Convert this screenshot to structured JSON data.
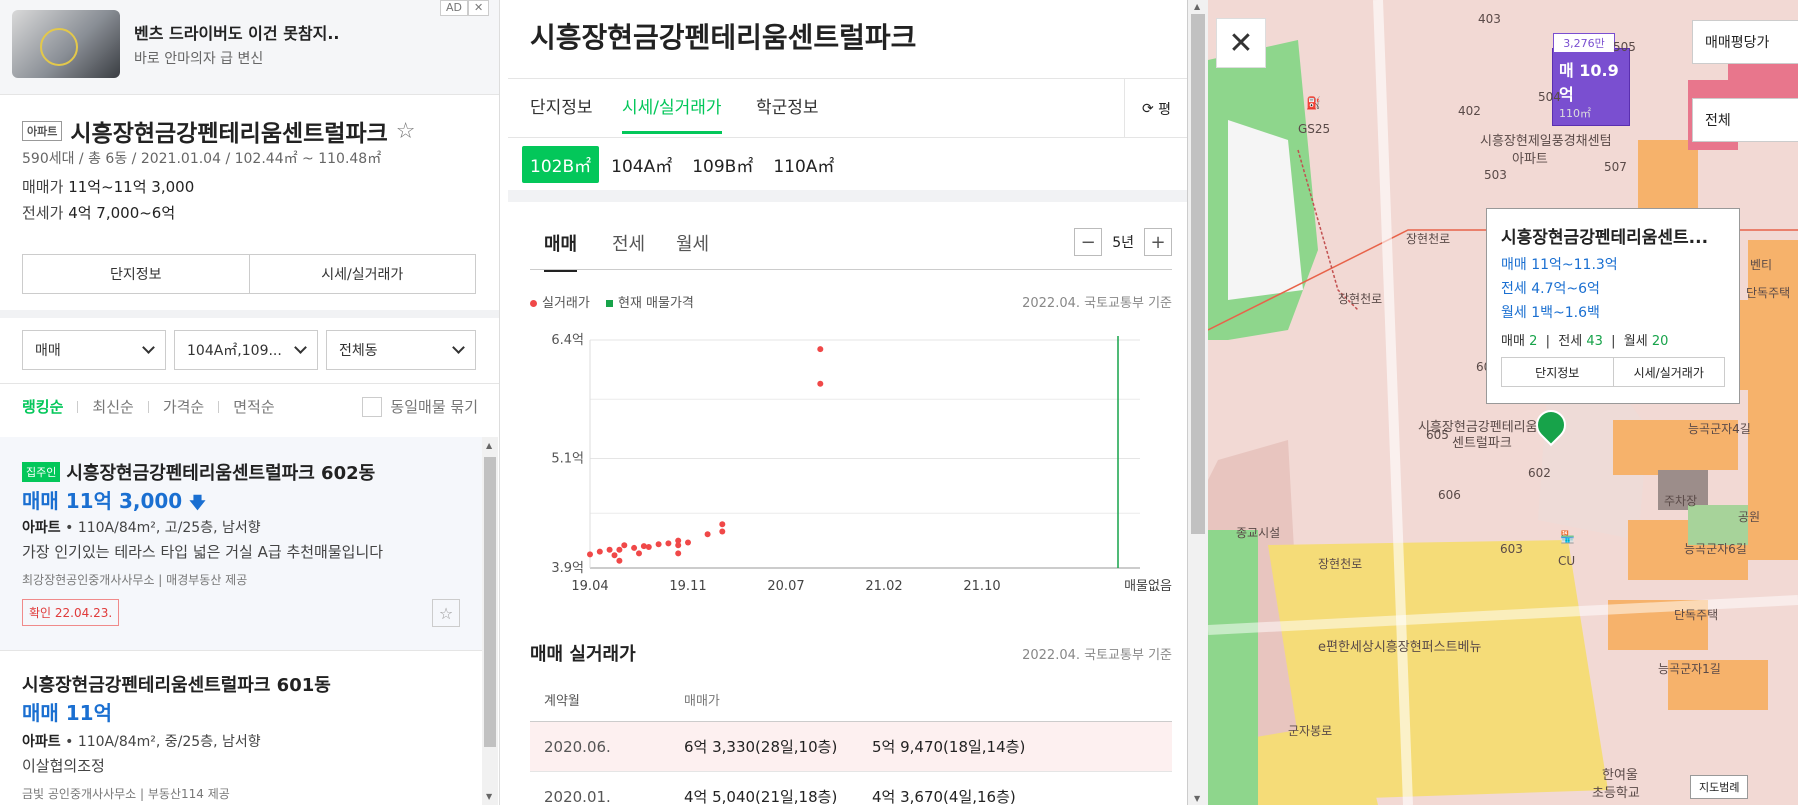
{
  "ad": {
    "badge": "AD",
    "close": "✕",
    "title": "벤츠 드라이버도 이건 못참지..",
    "subtitle": "바로 안마의자 급 변신"
  },
  "complex": {
    "tag": "아파트",
    "name": "시흥장현금강펜테리움센트럴파크",
    "star": "☆",
    "meta": "590세대 / 총 6동 / 2021.01.04 / 102.44㎡ ~ 110.48㎡",
    "sale_label": "매매가",
    "sale_value": "11억~11억 3,000",
    "jeonse_label": "전세가",
    "jeonse_value": "4억 7,000~6억",
    "btn_info": "단지정보",
    "btn_price": "시세/실거래가"
  },
  "filters": {
    "deal": "매매",
    "area": "104A㎡,109...",
    "dong": "전체동"
  },
  "sort": {
    "items": [
      "랭킹순",
      "최신순",
      "가격순",
      "면적순"
    ],
    "group": "동일매물 묶기"
  },
  "listings": [
    {
      "owner": "집주인",
      "name": "시흥장현금강펜테리움센트럴파크 602동",
      "price": "매매 11억 3,000",
      "type": "아파트",
      "spec": "110A/84m², 고/25층, 남서향",
      "desc": "가장 인기있는 테라스 타입 넓은 거실 A급 추천매물입니다",
      "agent": "최강장현공인중개사사무소",
      "source": "매경부동산 제공",
      "confirm": "확인 22.04.23."
    },
    {
      "name": "시흥장현금강펜테리움센트럴파크 601동",
      "price": "매매 11억",
      "type": "아파트",
      "spec": "110A/84m², 중/25층, 남서향",
      "desc": "이살협의조정",
      "agent": "금빛 공인중개사사무소",
      "source": "부동산114 제공"
    }
  ],
  "detail": {
    "title": "시흥장현금강펜테리움센트럴파크",
    "tabs": [
      "단지정보",
      "시세/실거래가",
      "학군정보"
    ],
    "unit_toggle": "평",
    "sizes": [
      "102B㎡",
      "104A㎡",
      "109B㎡",
      "110A㎡"
    ],
    "trade_tabs": [
      "매매",
      "전세",
      "월세"
    ],
    "period": "5년",
    "legend_actual": "실거래가",
    "legend_current": "현재 매물가격",
    "source": "2022.04. 국토교통부 기준",
    "table_title": "매매 실거래가",
    "table_head": [
      "계약월",
      "매매가"
    ],
    "rows": [
      {
        "month": "2020.06.",
        "p1": "6억 3,330(28일,10층)",
        "p2": "5억 9,470(18일,14층)"
      },
      {
        "month": "2020.01.",
        "p1": "4억 5,040(21일,18층)",
        "p2": "4억 3,670(4일,16층)"
      }
    ]
  },
  "chart_data": {
    "type": "scatter",
    "ylim": [
      3.9,
      6.4
    ],
    "yticks": [
      "6.4억",
      "5.1억",
      "3.9억"
    ],
    "xticks": [
      "19.04",
      "19.11",
      "20.07",
      "21.02",
      "21.10",
      "매물없음"
    ],
    "series": [
      {
        "name": "실거래가",
        "color": "#f04848",
        "points": [
          [
            0.0,
            4.05
          ],
          [
            0.1,
            4.08
          ],
          [
            0.2,
            4.1
          ],
          [
            0.25,
            4.04
          ],
          [
            0.3,
            3.98
          ],
          [
            0.3,
            4.1
          ],
          [
            0.35,
            4.15
          ],
          [
            0.45,
            4.12
          ],
          [
            0.5,
            4.06
          ],
          [
            0.55,
            4.14
          ],
          [
            0.6,
            4.13
          ],
          [
            0.7,
            4.16
          ],
          [
            0.8,
            4.17
          ],
          [
            0.9,
            4.15
          ],
          [
            0.9,
            4.06
          ],
          [
            0.9,
            4.2
          ],
          [
            1.0,
            4.18
          ],
          [
            1.2,
            4.27
          ],
          [
            1.35,
            4.3
          ],
          [
            1.35,
            4.38
          ],
          [
            2.35,
            6.3
          ],
          [
            2.35,
            5.92
          ]
        ]
      },
      {
        "name": "현재 매물가격",
        "color": "#17a34a",
        "points": []
      }
    ]
  },
  "map": {
    "close": "✕",
    "price_type": "매매평당가",
    "filter": "전체",
    "marker_top": "3,276만",
    "marker_price": "매 10.9억",
    "marker_area": "110㎡",
    "popup": {
      "title": "시흥장현금강펜테리움센트...",
      "sale": "매매 11억~11.3억",
      "jeonse": "전세 4.7억~6억",
      "monthly": "월세 1백~1.6백",
      "c_sale_l": "매매",
      "c_sale": "2",
      "c_jeonse_l": "전세",
      "c_jeonse": "43",
      "c_month_l": "월세",
      "c_month": "20",
      "btn_info": "단지정보",
      "btn_price": "시세/실거래가"
    },
    "labels": {
      "l403": "403",
      "l402": "402",
      "l505": "505",
      "l504": "504",
      "l503": "503",
      "l507": "507",
      "l604": "604",
      "l605": "605",
      "l606": "606",
      "l603": "603",
      "l602": "602",
      "gs25": "GS25",
      "cu": "CU",
      "center": "시흥장현제일풍경채센텀",
      "center2": "아파트",
      "complex1": "시흥장현금강펜테리움",
      "complex2": "센트럴파크",
      "road1": "장현천로",
      "road2": "장현천로",
      "road3": "군자봉로",
      "road4": "장현천로",
      "road5": "능곡군자4길",
      "road6": "능곡군자6길",
      "road7": "능곡군자1길",
      "jonggyo": "종교시설",
      "park": "주차장",
      "park2": "공원",
      "house1": "단독주택",
      "house2": "단독주택",
      "school1": "e편한세상시흥장현퍼스트베뉴",
      "school2": "한여울",
      "school3": "초등학교",
      "venti": "벤티",
      "legend": "지도범례"
    }
  }
}
